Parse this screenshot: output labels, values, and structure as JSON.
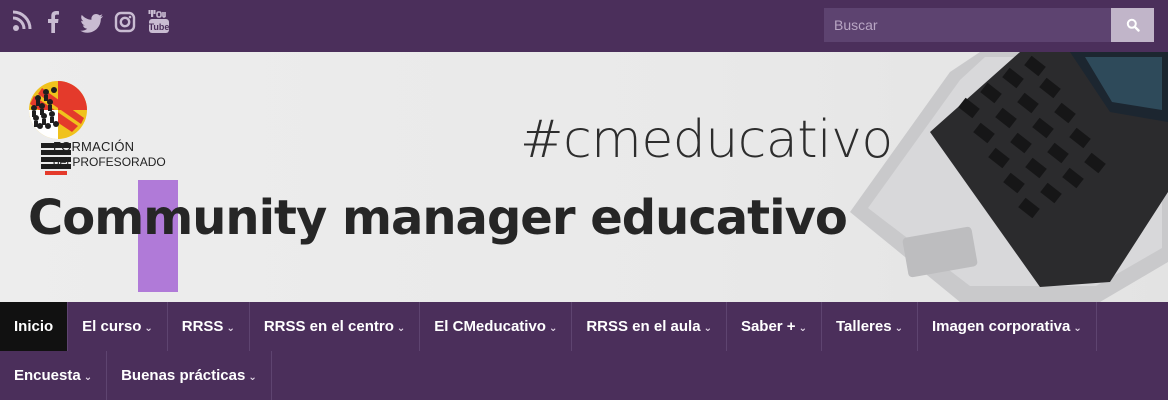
{
  "social": [
    {
      "name": "rss-icon"
    },
    {
      "name": "facebook-icon"
    },
    {
      "name": "twitter-icon"
    },
    {
      "name": "instagram-icon"
    },
    {
      "name": "youtube-icon"
    }
  ],
  "search": {
    "placeholder": "Buscar"
  },
  "logo": {
    "line1": "FORMACIÓN",
    "line2": "del PROFESORADO"
  },
  "hero": {
    "hashtag": "#cmeducativo",
    "title": "Community manager educativo"
  },
  "nav": {
    "row1": [
      {
        "label": "Inicio",
        "dropdown": false
      },
      {
        "label": "El curso",
        "dropdown": true
      },
      {
        "label": "RRSS",
        "dropdown": true
      },
      {
        "label": "RRSS en el centro",
        "dropdown": true
      },
      {
        "label": "El CMeducativo",
        "dropdown": true
      },
      {
        "label": "RRSS en el aula",
        "dropdown": true
      },
      {
        "label": "Saber +",
        "dropdown": true
      },
      {
        "label": "Talleres",
        "dropdown": true
      },
      {
        "label": "Imagen corporativa",
        "dropdown": true
      }
    ],
    "row2": [
      {
        "label": "Encuesta",
        "dropdown": true
      },
      {
        "label": "Buenas prácticas",
        "dropdown": true
      }
    ]
  },
  "colors": {
    "brand": "#4b2f5b",
    "accent": "#b07ad8",
    "active_nav": "#111111"
  }
}
